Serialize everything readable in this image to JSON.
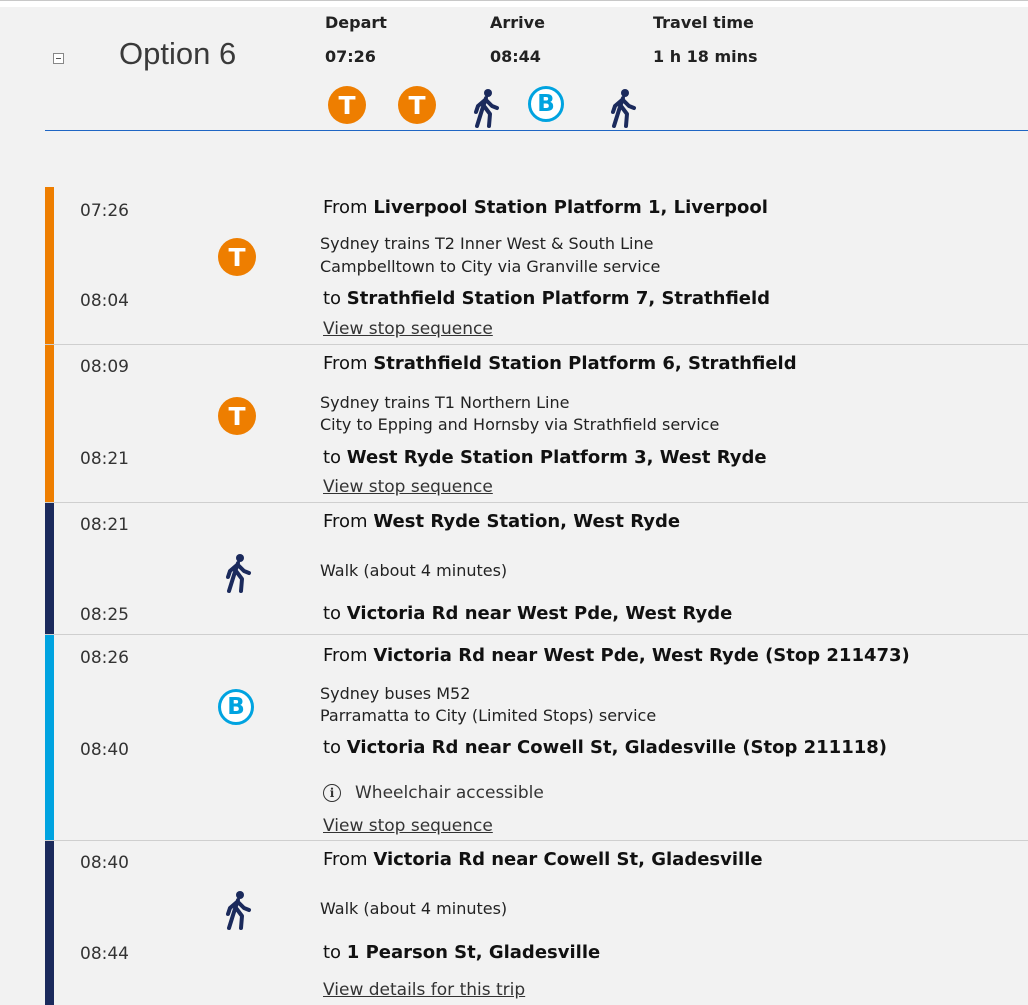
{
  "option": {
    "title": "Option 6"
  },
  "summary": {
    "depart_label": "Depart",
    "depart": "07:26",
    "arrive_label": "Arrive",
    "arrive": "08:44",
    "travel_label": "Travel time",
    "travel": "1 h 18 mins"
  },
  "modes": [
    {
      "type": "train",
      "glyph": "T",
      "icon": "train-icon"
    },
    {
      "type": "train",
      "glyph": "T",
      "icon": "train-icon"
    },
    {
      "type": "walk",
      "icon": "walk-icon"
    },
    {
      "type": "bus",
      "glyph": "B",
      "icon": "bus-icon"
    },
    {
      "type": "walk",
      "icon": "walk-icon"
    }
  ],
  "colors": {
    "train": "#ee7e00",
    "walk": "#1b2a5c",
    "bus": "#00a3e0",
    "accent": "#1f66c4"
  },
  "legs": [
    {
      "type": "train",
      "dep_time": "07:26",
      "from_prefix": "From ",
      "from": "Liverpool Station Platform 1, Liverpool",
      "desc1": "Sydney trains T2 Inner West & South Line",
      "desc2": "Campbelltown to City via Granville service",
      "arr_time": "08:04",
      "to_prefix": "to ",
      "to": "Strathfield Station Platform 7, Strathfield",
      "link": "View stop sequence"
    },
    {
      "type": "train",
      "dep_time": "08:09",
      "from_prefix": "From ",
      "from": "Strathfield Station Platform 6, Strathfield",
      "desc1": "Sydney trains T1 Northern Line",
      "desc2": "City to Epping and Hornsby via Strathfield service",
      "arr_time": "08:21",
      "to_prefix": "to ",
      "to": "West Ryde Station Platform 3, West Ryde",
      "link": "View stop sequence"
    },
    {
      "type": "walk",
      "dep_time": "08:21",
      "from_prefix": "From ",
      "from": "West Ryde Station, West Ryde",
      "desc1": "Walk (about 4 minutes)",
      "arr_time": "08:25",
      "to_prefix": "to ",
      "to": "Victoria Rd near West Pde, West Ryde"
    },
    {
      "type": "bus",
      "dep_time": "08:26",
      "from_prefix": "From ",
      "from": "Victoria Rd near West Pde, West Ryde (Stop 211473)",
      "desc1": "Sydney buses M52",
      "desc2": "Parramatta to City (Limited Stops) service",
      "arr_time": "08:40",
      "to_prefix": "to ",
      "to": "Victoria Rd near Cowell St, Gladesville (Stop 211118)",
      "info": "Wheelchair accessible",
      "link": "View stop sequence"
    },
    {
      "type": "walk",
      "dep_time": "08:40",
      "from_prefix": "From ",
      "from": "Victoria Rd near Cowell St, Gladesville",
      "desc1": "Walk (about 4 minutes)",
      "arr_time": "08:44",
      "to_prefix": "to ",
      "to": "1 Pearson St, Gladesville",
      "link": "View details for this trip"
    }
  ]
}
